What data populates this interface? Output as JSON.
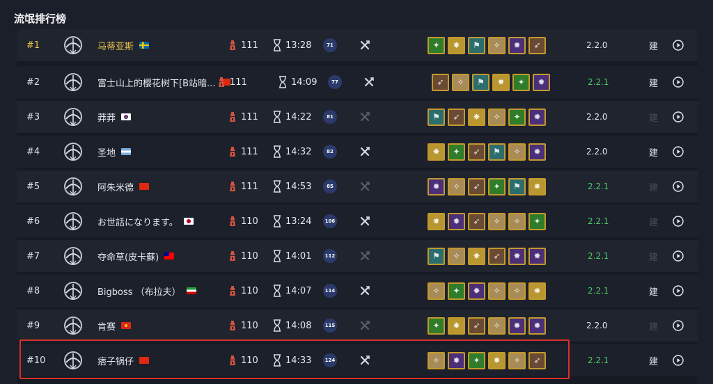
{
  "page_title": "流氓排行榜",
  "colors": {
    "gold": "#e8c34a",
    "green_version": "#4cc96b",
    "badge": "#2b3a6a",
    "highlight": "#d9302a"
  },
  "skill_palette": {
    "green": "#2f7d2a",
    "gold": "#b89630",
    "teal": "#2c6e6e",
    "tan": "#a88b57",
    "purple": "#4b2f79",
    "brown": "#6b4a34"
  },
  "rows": [
    {
      "rank": "#1",
      "name": "马蒂亚斯",
      "flag": "flag-sweden",
      "level": "111",
      "time": "13:28",
      "badge": "71",
      "cross_dim": false,
      "skills": [
        "green",
        "gold",
        "teal",
        "tan",
        "purple",
        "brown"
      ],
      "version": "2.2.0",
      "version_green": false,
      "build": "建",
      "build_dim": false
    },
    {
      "rank": "#2",
      "name": "富士山上的樱花树下[B站暗...",
      "flag": "flag-china",
      "level": "111",
      "time": "14:09",
      "badge": "77",
      "cross_dim": false,
      "skills": [
        "brown",
        "tan",
        "teal",
        "gold",
        "green",
        "purple"
      ],
      "version": "2.2.1",
      "version_green": true,
      "build": "建",
      "build_dim": false
    },
    {
      "rank": "#3",
      "name": "莽莽",
      "flag": "flag-korea",
      "level": "111",
      "time": "14:22",
      "badge": "81",
      "cross_dim": true,
      "skills": [
        "teal",
        "brown",
        "gold",
        "tan",
        "green",
        "purple"
      ],
      "version": "2.2.0",
      "version_green": false,
      "build": "建",
      "build_dim": true
    },
    {
      "rank": "#4",
      "name": "圣地",
      "flag": "flag-argentina",
      "level": "111",
      "time": "14:32",
      "badge": "82",
      "cross_dim": false,
      "skills": [
        "gold",
        "green",
        "brown",
        "teal",
        "tan",
        "purple"
      ],
      "version": "2.2.0",
      "version_green": false,
      "build": "建",
      "build_dim": false
    },
    {
      "rank": "#5",
      "name": "阿朱米德",
      "flag": "flag-china",
      "level": "111",
      "time": "14:53",
      "badge": "85",
      "cross_dim": true,
      "skills": [
        "purple",
        "tan",
        "brown",
        "green",
        "teal",
        "gold"
      ],
      "version": "2.2.1",
      "version_green": true,
      "build": "建",
      "build_dim": true
    },
    {
      "rank": "#6",
      "name": "お世話になります。",
      "flag": "flag-japan",
      "level": "110",
      "time": "13:24",
      "badge": "106",
      "cross_dim": false,
      "skills": [
        "gold",
        "purple",
        "brown",
        "tan",
        "tan",
        "green"
      ],
      "version": "2.2.1",
      "version_green": true,
      "build": "建",
      "build_dim": true
    },
    {
      "rank": "#7",
      "name": "夺命草(皮卡蘇)",
      "flag": "flag-taiwan",
      "level": "110",
      "time": "14:01",
      "badge": "112",
      "cross_dim": true,
      "skills": [
        "teal",
        "tan",
        "gold",
        "brown",
        "purple",
        "purple"
      ],
      "version": "2.2.1",
      "version_green": true,
      "build": "建",
      "build_dim": true
    },
    {
      "rank": "#8",
      "name": "Bigboss （布拉夫）",
      "flag": "flag-iran",
      "level": "110",
      "time": "14:07",
      "badge": "114",
      "cross_dim": false,
      "skills": [
        "tan",
        "green",
        "purple",
        "tan",
        "tan",
        "gold"
      ],
      "version": "2.2.1",
      "version_green": true,
      "build": "建",
      "build_dim": false
    },
    {
      "rank": "#9",
      "name": "肯赛",
      "flag": "flag-vietnam",
      "level": "110",
      "time": "14:08",
      "badge": "115",
      "cross_dim": true,
      "skills": [
        "green",
        "gold",
        "brown",
        "tan",
        "purple",
        "purple"
      ],
      "version": "2.2.0",
      "version_green": false,
      "build": "建",
      "build_dim": true
    },
    {
      "rank": "#10",
      "name": "痞子锅仔",
      "flag": "flag-china",
      "level": "110",
      "time": "14:33",
      "badge": "124",
      "cross_dim": false,
      "skills": [
        "tan",
        "purple",
        "green",
        "gold",
        "tan",
        "brown"
      ],
      "version": "2.2.1",
      "version_green": true,
      "build": "建",
      "build_dim": false
    }
  ]
}
